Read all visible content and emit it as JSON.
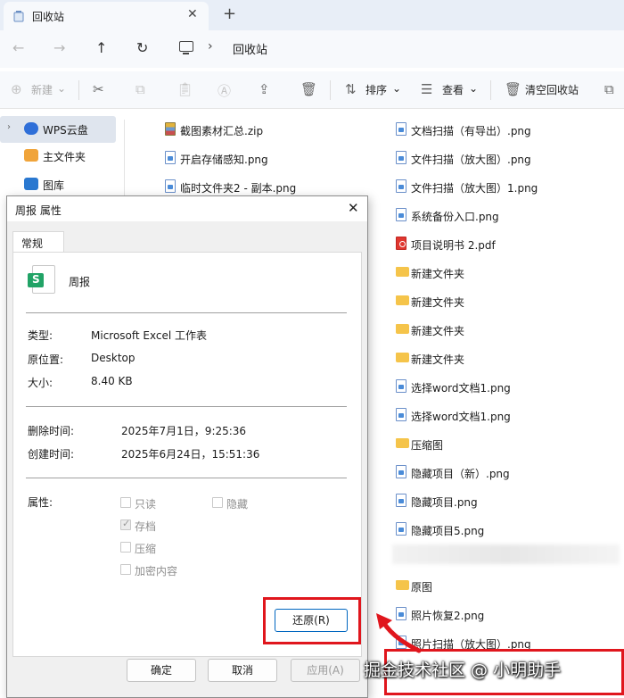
{
  "window": {
    "tab_title": "回收站",
    "new_tab": "+",
    "tab_close": "✕"
  },
  "nav": {
    "back": "←",
    "forward": "→",
    "up": "↑",
    "refresh": "↻",
    "breadcrumb_sep": "›",
    "breadcrumb": "回收站"
  },
  "toolbar": {
    "new_label": "新建",
    "sort_label": "排序",
    "view_label": "查看",
    "empty_label": "清空回收站"
  },
  "sidebar": {
    "items": [
      {
        "label": "WPS云盘",
        "color": "#2f6fd8"
      },
      {
        "label": "主文件夹",
        "color": "#f0a43a"
      },
      {
        "label": "图库",
        "color": "#2a78d0"
      }
    ]
  },
  "files": {
    "left": [
      {
        "name": "截图素材汇总.zip",
        "type": "zip"
      },
      {
        "name": "开启存储感知.png",
        "type": "img"
      },
      {
        "name": "临时文件夹2 - 副本.png",
        "type": "img"
      }
    ],
    "right": [
      {
        "name": "文档扫描（有导出）.png",
        "type": "img"
      },
      {
        "name": "文件扫描（放大图）.png",
        "type": "img"
      },
      {
        "name": "文件扫描（放大图）1.png",
        "type": "img"
      },
      {
        "name": "系统备份入口.png",
        "type": "img"
      },
      {
        "name": "项目说明书 2.pdf",
        "type": "pdf"
      },
      {
        "name": "新建文件夹",
        "type": "folder"
      },
      {
        "name": "新建文件夹",
        "type": "folder"
      },
      {
        "name": "新建文件夹",
        "type": "folder"
      },
      {
        "name": "新建文件夹",
        "type": "folder"
      },
      {
        "name": "选择word文档1.png",
        "type": "img"
      },
      {
        "name": "选择word文档1.png",
        "type": "img"
      },
      {
        "name": "压缩图",
        "type": "folder"
      },
      {
        "name": "隐藏项目（新）.png",
        "type": "img"
      },
      {
        "name": "隐藏项目.png",
        "type": "img"
      },
      {
        "name": "隐藏项目5.png",
        "type": "img"
      },
      {
        "name": "原图",
        "type": "folder"
      },
      {
        "name": "照片恢复2.png",
        "type": "img"
      },
      {
        "name": "照片扫描（放大图）.png",
        "type": "img"
      }
    ]
  },
  "dialog": {
    "title": "周报 属性",
    "close": "✕",
    "tab": "常规",
    "file_name": "周报",
    "type_label": "类型:",
    "type_value": "Microsoft Excel 工作表",
    "location_label": "原位置:",
    "location_value": "Desktop",
    "size_label": "大小:",
    "size_value": "8.40 KB",
    "deleted_label": "删除时间:",
    "deleted_value": "2025年7月1日，9:25:36",
    "created_label": "创建时间:",
    "created_value": "2025年6月24日，15:51:36",
    "attributes_label": "属性:",
    "attributes": {
      "readonly": {
        "label": "只读",
        "checked": false
      },
      "hidden": {
        "label": "隐藏",
        "checked": false
      },
      "archive": {
        "label": "存档",
        "checked": true
      },
      "compress": {
        "label": "压缩",
        "checked": false
      },
      "encrypt": {
        "label": "加密内容",
        "checked": false
      }
    },
    "restore_button": "还原(R)",
    "ok_button": "确定",
    "cancel_button": "取消",
    "apply_button": "应用(A)"
  },
  "watermark": "掘金技术社区 @ 小明助手",
  "colors": {
    "accent": "#0067c0",
    "highlight": "#e0161d",
    "excel": "#21a366",
    "folder": "#f5c44a"
  }
}
